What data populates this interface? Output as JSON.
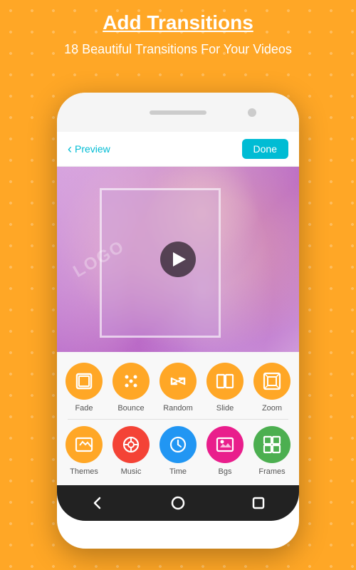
{
  "header": {
    "title": "Add Transitions",
    "subtitle": "18 Beautiful Transitions For Your Videos"
  },
  "phone": {
    "app_header": {
      "back_label": "Preview",
      "done_label": "Done"
    },
    "toolbar_row1": [
      {
        "id": "fade",
        "label": "Fade",
        "icon": "⊡"
      },
      {
        "id": "bounce",
        "label": "Bounce",
        "icon": "⁙"
      },
      {
        "id": "random",
        "label": "Random",
        "icon": "⇄"
      },
      {
        "id": "slide",
        "label": "Slide",
        "icon": "▣"
      },
      {
        "id": "zoom",
        "label": "Zoom",
        "icon": "⊞"
      }
    ],
    "toolbar_row2": [
      {
        "id": "themes",
        "label": "Themes",
        "icon": "🖼"
      },
      {
        "id": "music",
        "label": "Music",
        "icon": "♪"
      },
      {
        "id": "time",
        "label": "Time",
        "icon": "🕐"
      },
      {
        "id": "bgs",
        "label": "Bgs",
        "icon": "🖼"
      },
      {
        "id": "frames",
        "label": "Frames",
        "icon": "⊞"
      }
    ],
    "nav": {
      "back_label": "◁",
      "home_label": "○",
      "recent_label": "□"
    }
  },
  "colors": {
    "accent": "#FFA726",
    "header_bg": "#FFA726",
    "done_btn": "#00BCD4",
    "back_color": "#00BCD4",
    "themes_color": "#FFA726",
    "music_color": "#F44336",
    "time_color": "#2196F3",
    "bgs_color": "#E91E8C",
    "frames_color": "#4CAF50"
  }
}
